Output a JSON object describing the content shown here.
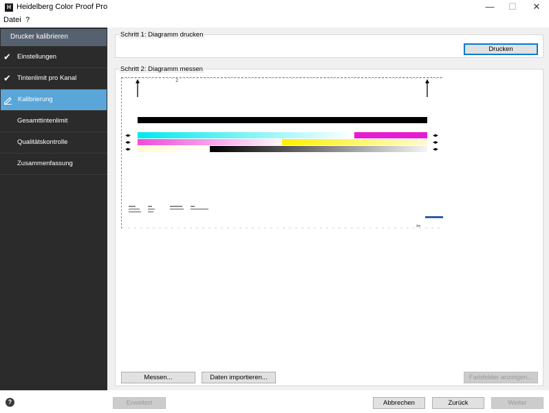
{
  "window": {
    "title": "Heidelberg Color Proof Pro",
    "icon": "H",
    "minimize": "—",
    "maximize": "☐",
    "close": "✕"
  },
  "menu": {
    "items": [
      "Datei",
      "?"
    ]
  },
  "sidebar": {
    "header": "Drucker kalibrieren",
    "items": [
      {
        "label": "Einstellungen",
        "status": "done"
      },
      {
        "label": "Tintenlimit pro Kanal",
        "status": "done"
      },
      {
        "label": "Kalibrierung",
        "status": "active"
      },
      {
        "label": "Gesamttintenlimit",
        "status": ""
      },
      {
        "label": "Qualitätskontrolle",
        "status": ""
      },
      {
        "label": "Zusammenfassung",
        "status": ""
      }
    ]
  },
  "step1": {
    "label": "Schritt 1: Diagramm drucken",
    "print_button": "Drucken"
  },
  "step2": {
    "label": "Schritt 2: Diagramm messen",
    "measure_button": "Messen...",
    "import_button": "Daten importieren...",
    "show_patches_button": "Farbfelder anzeigen...",
    "chart_logo": "HEIDELBERG"
  },
  "footer": {
    "advanced": "Erweitert",
    "cancel": "Abbrechen",
    "back": "Zurück",
    "next": "Weiter",
    "help_icon": "?"
  },
  "colors": {
    "sidebar_bg": "#2b2b2b",
    "active_item": "#5aa6d9",
    "header_bg": "#566170",
    "accent": "#0078d7"
  }
}
